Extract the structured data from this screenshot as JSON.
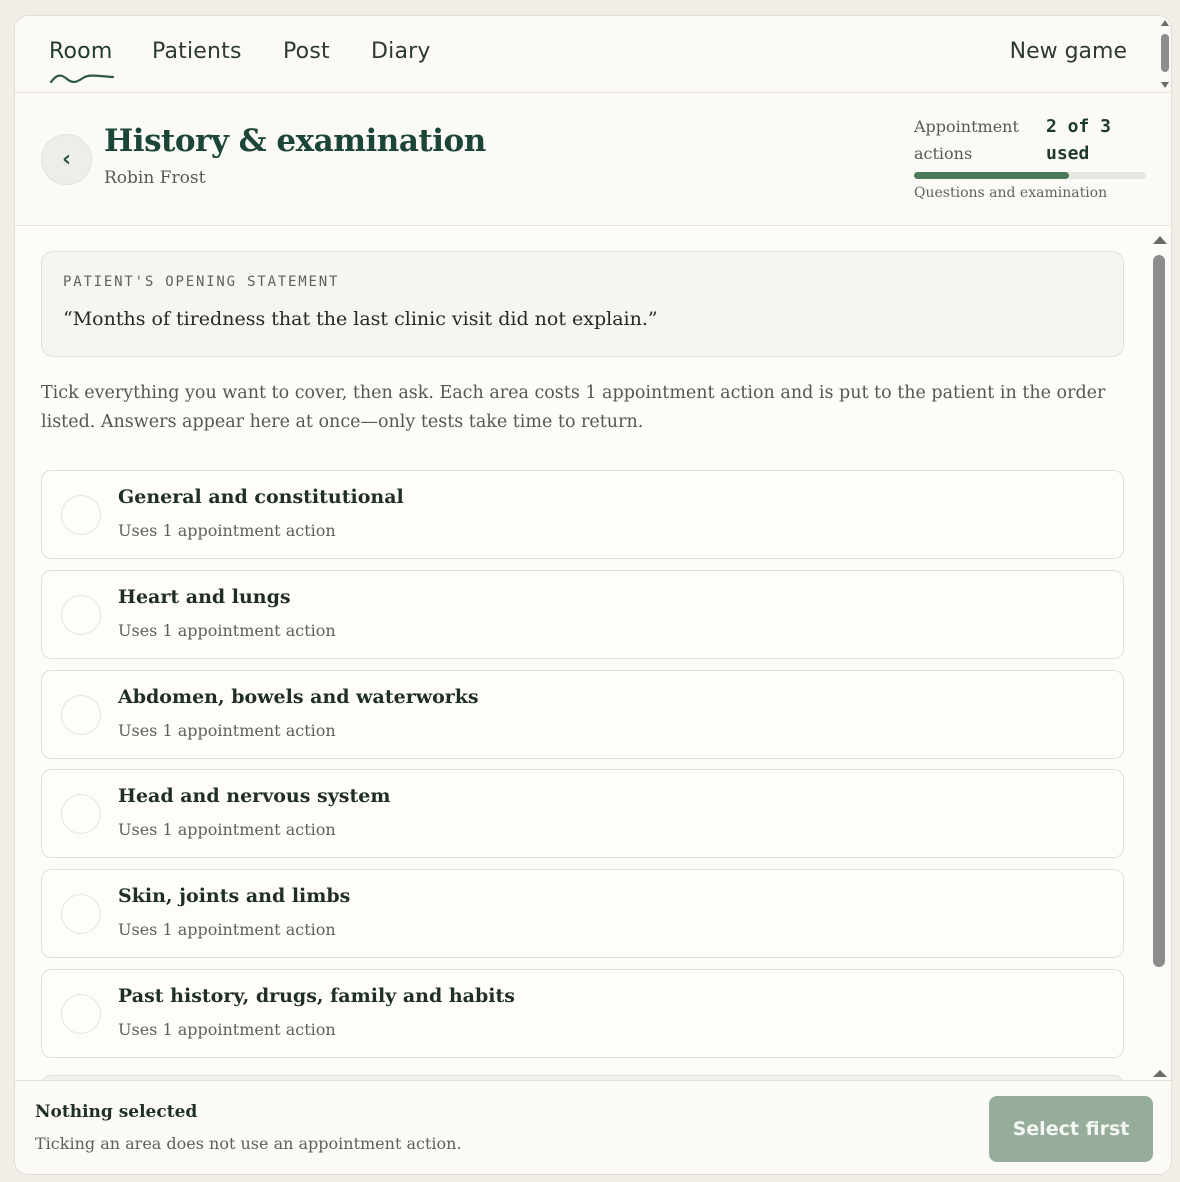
{
  "nav": {
    "tabs": [
      {
        "label": "Room",
        "active": true
      },
      {
        "label": "Patients"
      },
      {
        "label": "Post"
      },
      {
        "label": "Diary"
      }
    ],
    "new_game_label": "New game"
  },
  "header": {
    "back_glyph": "‹",
    "title": "History & examination",
    "patient_name": "Robin Frost",
    "actions_label": "Appointment actions",
    "actions_count": "2 of 3 used",
    "actions_used_fraction": 0.6667,
    "actions_caption": "Questions and examination"
  },
  "statement": {
    "label": "PATIENT'S OPENING STATEMENT",
    "text": "“Months of tiredness that the last clinic visit did not explain.”"
  },
  "instructions": "Tick everything you want to cover, then ask. Each area costs 1 appointment action and is put to the patient in the order listed. Answers appear here at once—only tests take time to return.",
  "areas": [
    {
      "title": "General and constitutional",
      "cost": "Uses 1 appointment action"
    },
    {
      "title": "Heart and lungs",
      "cost": "Uses 1 appointment action"
    },
    {
      "title": "Abdomen, bowels and waterworks",
      "cost": "Uses 1 appointment action"
    },
    {
      "title": "Head and nervous system",
      "cost": "Uses 1 appointment action"
    },
    {
      "title": "Skin, joints and limbs",
      "cost": "Uses 1 appointment action"
    },
    {
      "title": "Past history, drugs, family and habits",
      "cost": "Uses 1 appointment action"
    }
  ],
  "footer": {
    "status": "Nothing selected",
    "note": "Ticking an area does not use an appointment action.",
    "button_label": "Select first"
  },
  "colors": {
    "accent": "#1b4637",
    "progress": "#4c7a5c",
    "button_disabled": "#97ad9c",
    "background": "#fdfcf8"
  }
}
